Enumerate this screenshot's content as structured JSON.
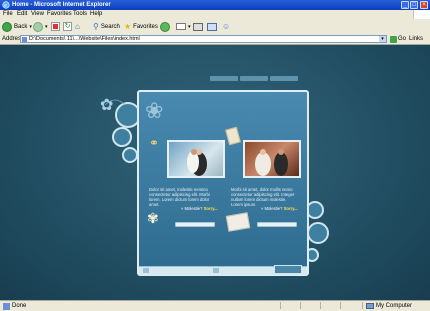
{
  "window": {
    "title": "Home - Microsoft Internet Explorer",
    "min_glyph": "_",
    "max_glyph": "□",
    "close_glyph": "×"
  },
  "menu": [
    "File",
    "Edit",
    "View",
    "Favorites",
    "Tools",
    "Help"
  ],
  "toolbar": {
    "back_label": "Back",
    "search_label": "Search",
    "favorites_label": "Favorites"
  },
  "address": {
    "label": "Address",
    "url": "D:\\Documents\\ 11\\...\\Website\\Files\\index.html",
    "go_label": "Go",
    "links_label": "Links"
  },
  "status": {
    "left_text": "Done",
    "zone_text": "My Computer"
  },
  "site": {
    "left_paragraph": "Dolor sit amet, molestie nemmo consectetur adipiscing elit. Morbi lorem. Lorem dictum lorem dolor amet.",
    "right_paragraph": "Morbi sit amet, dolor mollis nemo consectetur adipiscing elit. Integer nullam lorem dictum molestie. Lorem ipsum.",
    "more_text": "» Molestie?",
    "more_link": "Sorry...",
    "colors": {
      "page_bg": "#1f4a5e",
      "panel": "#3d7aa0",
      "accent": "#ffe04a"
    }
  }
}
